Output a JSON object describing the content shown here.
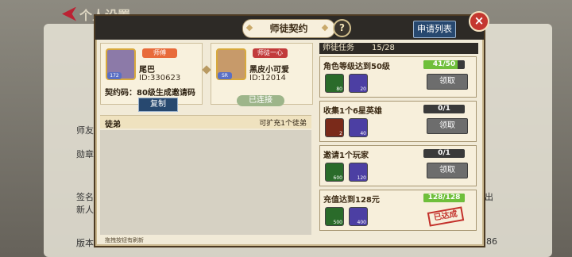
{
  "background": {
    "back_label": "个人设置",
    "left_labels": [
      "师友",
      "勋章",
      "签名",
      "新人",
      "版本"
    ],
    "right_labels": [
      "出",
      "86"
    ]
  },
  "dialog": {
    "title": "师徒契约",
    "apply_label": "申请列表",
    "close": "×",
    "help": "?"
  },
  "master": {
    "role": "师傅",
    "name": "尾巴",
    "id": "ID:330623",
    "level": "172"
  },
  "partner": {
    "role": "师徒一心",
    "name": "黑皮小可爱",
    "id": "ID:12014",
    "level": "SR"
  },
  "contract": {
    "code_text": "契约码：80级生成邀请码",
    "copy_label": "复制",
    "status": "已连接"
  },
  "disciples": {
    "label": "徒弟",
    "expand_text": "可扩充1个徒弟",
    "scroll_hint": "拖拽按钮有刷新"
  },
  "tasks": {
    "header": "师徒任务",
    "progress": "15/28",
    "items": [
      {
        "name": "角色等级达到50级",
        "progress": "41/50",
        "ratio": 0.82,
        "rewards": [
          {
            "color": "#2a6b2a",
            "qty": "80"
          },
          {
            "color": "#4c3fa3",
            "qty": "20"
          }
        ],
        "action": "领取"
      },
      {
        "name": "收集1个6星英雄",
        "progress": "0/1",
        "ratio": 0,
        "rewards": [
          {
            "color": "#7a2a1a",
            "qty": "2"
          },
          {
            "color": "#4c3fa3",
            "qty": "40"
          }
        ],
        "action": "领取"
      },
      {
        "name": "邀请1个玩家",
        "progress": "0/1",
        "ratio": 0,
        "rewards": [
          {
            "color": "#2a6b2a",
            "qty": "600"
          },
          {
            "color": "#4c3fa3",
            "qty": "120"
          }
        ],
        "action": "领取"
      },
      {
        "name": "充值达到128元",
        "progress": "128/128",
        "ratio": 1,
        "rewards": [
          {
            "color": "#2a6b2a",
            "qty": "500"
          },
          {
            "color": "#4c3fa3",
            "qty": "400"
          }
        ],
        "action": "已达成"
      }
    ]
  }
}
